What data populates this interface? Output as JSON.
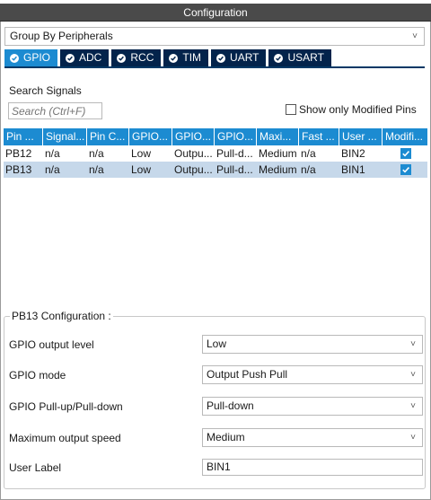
{
  "window": {
    "title": "Configuration"
  },
  "group_by": {
    "value": "Group By Peripherals",
    "chevron": "˅"
  },
  "tabs": [
    {
      "label": "GPIO",
      "active": true
    },
    {
      "label": "ADC",
      "active": false
    },
    {
      "label": "RCC",
      "active": false
    },
    {
      "label": "TIM",
      "active": false
    },
    {
      "label": "UART",
      "active": false
    },
    {
      "label": "USART",
      "active": false
    }
  ],
  "search": {
    "label": "Search Signals",
    "placeholder": "Search (Ctrl+F)"
  },
  "show_modified": {
    "label": "Show only Modified Pins",
    "checked": false
  },
  "table": {
    "headers": [
      "Pin ...",
      "Signal...",
      "Pin C...",
      "GPIO...",
      "GPIO...",
      "GPIO...",
      "Maxi...",
      "Fast ...",
      "User ...",
      "Modifi..."
    ],
    "rows": [
      {
        "pin": "PB12",
        "signal": "n/a",
        "pin_context": "n/a",
        "gpio_level": "Low",
        "gpio_mode": "Outpu...",
        "gpio_pull": "Pull-d...",
        "max_speed": "Medium",
        "fast_mode": "n/a",
        "user_label": "BIN2",
        "modified": true,
        "selected": false
      },
      {
        "pin": "PB13",
        "signal": "n/a",
        "pin_context": "n/a",
        "gpio_level": "Low",
        "gpio_mode": "Outpu...",
        "gpio_pull": "Pull-d...",
        "max_speed": "Medium",
        "fast_mode": "n/a",
        "user_label": "BIN1",
        "modified": true,
        "selected": true
      }
    ]
  },
  "pin_config": {
    "title": "PB13 Configuration :",
    "output_level": {
      "label": "GPIO output level",
      "value": "Low"
    },
    "mode": {
      "label": "GPIO mode",
      "value": "Output Push Pull"
    },
    "pull": {
      "label": "GPIO Pull-up/Pull-down",
      "value": "Pull-down"
    },
    "speed": {
      "label": "Maximum output speed",
      "value": "Medium"
    },
    "user_label": {
      "label": "User Label",
      "value": "BIN1"
    }
  },
  "colors": {
    "accent": "#1c8bd1",
    "tab_dark": "#03234b",
    "selected_row": "#c6d8ea",
    "titlebar": "#4a4a4a"
  }
}
